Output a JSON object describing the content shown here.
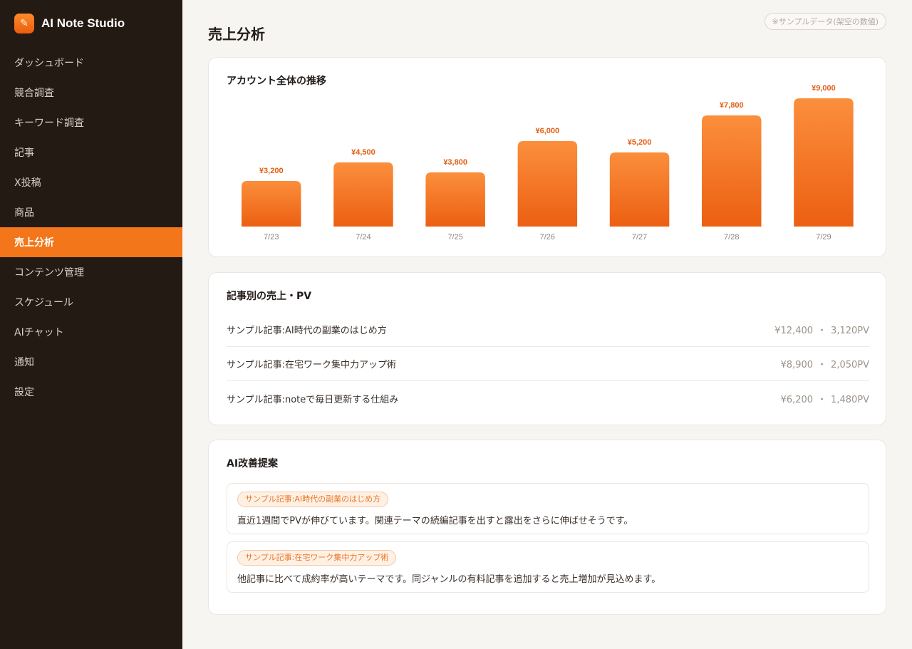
{
  "app": {
    "name": "AI Note Studio",
    "logo_icon": "note-flame-icon"
  },
  "sidebar": {
    "items": [
      {
        "label": "ダッシュボード",
        "active": false
      },
      {
        "label": "競合調査",
        "active": false
      },
      {
        "label": "キーワード調査",
        "active": false
      },
      {
        "label": "記事",
        "active": false
      },
      {
        "label": "X投稿",
        "active": false
      },
      {
        "label": "商品",
        "active": false
      },
      {
        "label": "売上分析",
        "active": true
      },
      {
        "label": "コンテンツ管理",
        "active": false
      },
      {
        "label": "スケジュール",
        "active": false
      },
      {
        "label": "AIチャット",
        "active": false
      },
      {
        "label": "通知",
        "active": false
      },
      {
        "label": "設定",
        "active": false
      }
    ]
  },
  "page": {
    "title": "売上分析",
    "sample_badge": "※サンプルデータ(架空の数値)"
  },
  "chart_card": {
    "title": "アカウント全体の推移"
  },
  "chart_data": {
    "type": "bar",
    "categories": [
      "7/23",
      "7/24",
      "7/25",
      "7/26",
      "7/27",
      "7/28",
      "7/29"
    ],
    "values": [
      3200,
      4500,
      3800,
      6000,
      5200,
      7800,
      9000
    ],
    "value_labels": [
      "¥3,200",
      "¥4,500",
      "¥3,800",
      "¥6,000",
      "¥5,200",
      "¥7,800",
      "¥9,000"
    ],
    "title": "アカウント全体の推移",
    "xlabel": "",
    "ylabel": "",
    "ylim": [
      0,
      10000
    ],
    "grid": false,
    "colors": {
      "bar_top": "#fb8f3c",
      "bar_bottom": "#ec5f12",
      "label": "#e45d12",
      "tick": "#8e857d"
    }
  },
  "articles_card": {
    "title": "記事別の売上・PV",
    "rows": [
      {
        "title": "サンプル記事:AI時代の副業のはじめ方",
        "sales": "¥12,400",
        "separator": "・",
        "pv": "3,120PV"
      },
      {
        "title": "サンプル記事:在宅ワーク集中力アップ術",
        "sales": "¥8,900",
        "separator": "・",
        "pv": "2,050PV"
      },
      {
        "title": "サンプル記事:noteで毎日更新する仕組み",
        "sales": "¥6,200",
        "separator": "・",
        "pv": "1,480PV"
      }
    ]
  },
  "ai_card": {
    "title": "AI改善提案",
    "suggestions": [
      {
        "tag": "サンプル記事:AI時代の副業のはじめ方",
        "text": "直近1週間でPVが伸びています。関連テーマの続編記事を出すと露出をさらに伸ばせそうです。"
      },
      {
        "tag": "サンプル記事:在宅ワーク集中力アップ術",
        "text": "他記事に比べて成約率が高いテーマです。同ジャンルの有料記事を追加すると売上増加が見込めます。"
      }
    ]
  },
  "colors": {
    "accent": "#f3761a",
    "sidebar_bg": "#241a14",
    "page_bg": "#f7f5f2"
  }
}
